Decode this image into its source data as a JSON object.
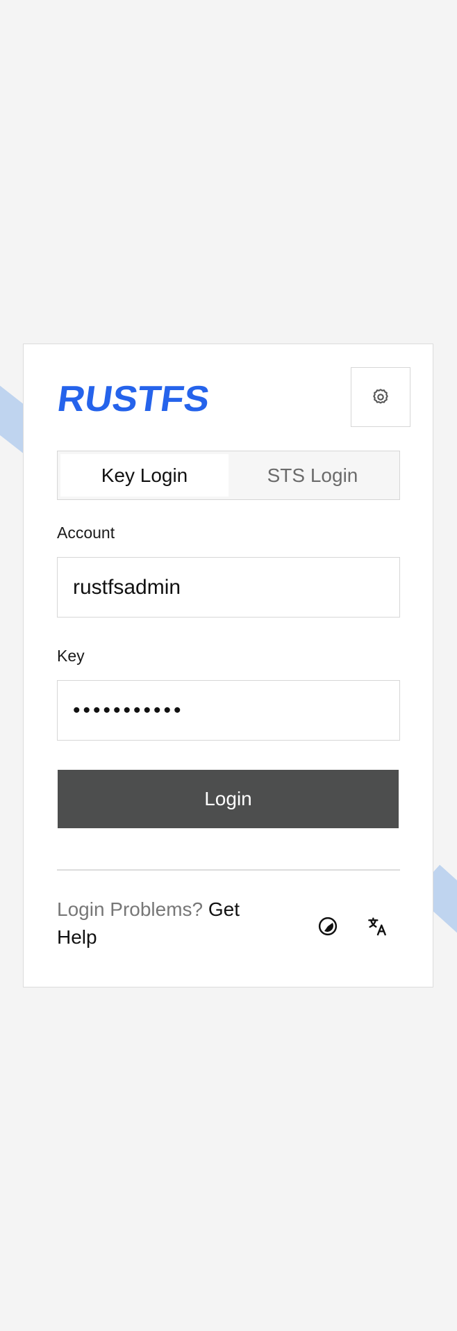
{
  "brand": {
    "logo_text": "RUSTFS",
    "color": "#2563eb"
  },
  "header": {
    "settings_icon": "gear-icon"
  },
  "tabs": [
    {
      "label": "Key Login",
      "active": true
    },
    {
      "label": "STS Login",
      "active": false
    }
  ],
  "form": {
    "account_label": "Account",
    "account_value": "rustfsadmin",
    "key_label": "Key",
    "key_value": "•••••••••••",
    "submit_label": "Login"
  },
  "footer": {
    "problems_text": "Login Problems?",
    "help_link": "Get Help",
    "theme_icon": "theme-toggle-icon",
    "language_icon": "translate-icon"
  },
  "colors": {
    "background": "#f4f4f4",
    "button": "#4d4e4e",
    "accent": "#2563eb"
  }
}
